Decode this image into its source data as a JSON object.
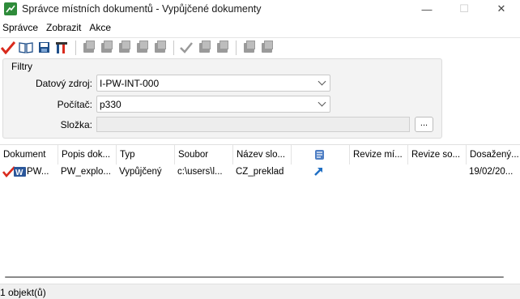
{
  "window": {
    "title": "Správce místních dokumentů - Vypůjčené dokumenty",
    "minimize": "—",
    "maximize": "☐",
    "close": "✕"
  },
  "menu": [
    "Správce",
    "Zobrazit",
    "Akce"
  ],
  "toolbar": {
    "buttons": [
      "check-in-icon",
      "open-book-icon",
      "save-icon",
      "tools-icon",
      "copy-out-icon",
      "free-icon",
      "export-icon",
      "import-icon",
      "purge-icon",
      "approve-icon",
      "refresh-icon",
      "update-icon",
      "merge-icon",
      "settings-icon"
    ]
  },
  "filters": {
    "title": "Filtry",
    "datasource_label": "Datový zdroj:",
    "datasource_value": "I-PW-INT-000",
    "computer_label": "Počítač:",
    "computer_value": "p330",
    "folder_label": "Složka:",
    "folder_value": "",
    "browse_label": "..."
  },
  "table": {
    "columns": [
      "Dokument",
      "Popis dok...",
      "Typ",
      "Soubor",
      "Název slo...",
      "",
      "Revize mí...",
      "Revize so...",
      "Dosažený..."
    ],
    "rows": [
      {
        "document": "PW...",
        "description": "PW_explo...",
        "type": "Vypůjčený",
        "file": "c:\\users\\l...",
        "folder": "CZ_preklad",
        "revision_local": "",
        "revision_server": "",
        "reached": "19/02/20..."
      }
    ]
  },
  "status": {
    "text": "1 objekt(ů)"
  },
  "colors": {
    "accent_red": "#d92a1c",
    "word_blue": "#2b579a",
    "check_green": "#2e8b3a"
  }
}
